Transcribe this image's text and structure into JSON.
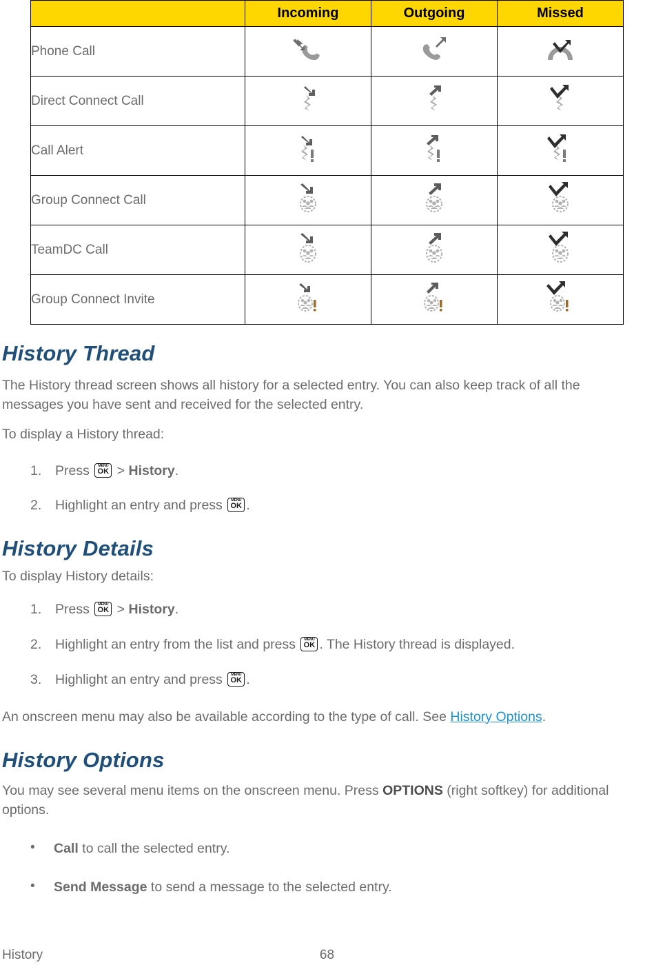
{
  "table": {
    "corner_label": "",
    "columns": [
      "Incoming",
      "Outgoing",
      "Missed"
    ],
    "header_bg": "#FFD700",
    "rows": [
      {
        "label": "Phone Call",
        "icons": [
          "phone-incoming-icon",
          "phone-outgoing-icon",
          "phone-missed-icon"
        ]
      },
      {
        "label": "Direct Connect Call",
        "icons": [
          "direct-connect-incoming-icon",
          "direct-connect-outgoing-icon",
          "direct-connect-missed-icon"
        ]
      },
      {
        "label": "Call Alert",
        "icons": [
          "call-alert-incoming-icon",
          "call-alert-outgoing-icon",
          "call-alert-missed-icon"
        ]
      },
      {
        "label": "Group Connect Call",
        "icons": [
          "group-connect-incoming-icon",
          "group-connect-outgoing-icon",
          "group-connect-missed-icon"
        ]
      },
      {
        "label": "TeamDC Call",
        "icons": [
          "teamdc-incoming-icon",
          "teamdc-outgoing-icon",
          "teamdc-missed-icon"
        ]
      },
      {
        "label": "Group Connect Invite",
        "icons": [
          "group-invite-incoming-icon",
          "group-invite-outgoing-icon",
          "group-invite-missed-icon"
        ]
      }
    ]
  },
  "sections": {
    "history_thread": {
      "heading": "History Thread",
      "intro": "The History thread screen shows all history for a selected entry. You can also keep track of all the messages you have sent and received for the selected entry.",
      "lead_in": "To display a History thread:",
      "steps": [
        {
          "num": "1.",
          "before": "Press ",
          "after_key": " > ",
          "bold": "History",
          "tail": "."
        },
        {
          "num": "2.",
          "before": "Highlight an entry and press ",
          "after_key": "",
          "bold": "",
          "tail": "."
        }
      ]
    },
    "history_details": {
      "heading": "History Details",
      "lead_in": "To display History details:",
      "steps": [
        {
          "num": "1.",
          "before": "Press ",
          "after_key": " > ",
          "bold": "History",
          "tail": "."
        },
        {
          "num": "2.",
          "before": "Highlight an entry from the list and press ",
          "after_key": ". The History thread is displayed.",
          "bold": "",
          "tail": ""
        },
        {
          "num": "3.",
          "before": "Highlight an entry and press ",
          "after_key": "",
          "bold": "",
          "tail": "."
        }
      ],
      "closing_before": "An onscreen menu may also be available according to the type of call. See ",
      "closing_link": "History Options",
      "closing_after": "."
    },
    "history_options": {
      "heading": "History Options",
      "intro_before": "You may see several menu items on the onscreen menu. Press ",
      "intro_bold": "OPTIONS",
      "intro_after": " (right softkey) for additional options.",
      "bullets": [
        {
          "bold": "Call",
          "text": " to call the selected entry."
        },
        {
          "bold": "Send Message",
          "text": " to send a message to the selected entry."
        }
      ]
    }
  },
  "footer": {
    "chapter": "History",
    "page_number": "68"
  },
  "colors": {
    "heading_blue": "#1F4E79",
    "link_blue": "#1F92D0",
    "table_header_yellow": "#FFD700",
    "body_gray": "#6B6B6B"
  },
  "icons": {
    "menu_ok_key": {
      "top_label": "MENU",
      "bottom_label": "OK"
    },
    "bullet": "•"
  }
}
